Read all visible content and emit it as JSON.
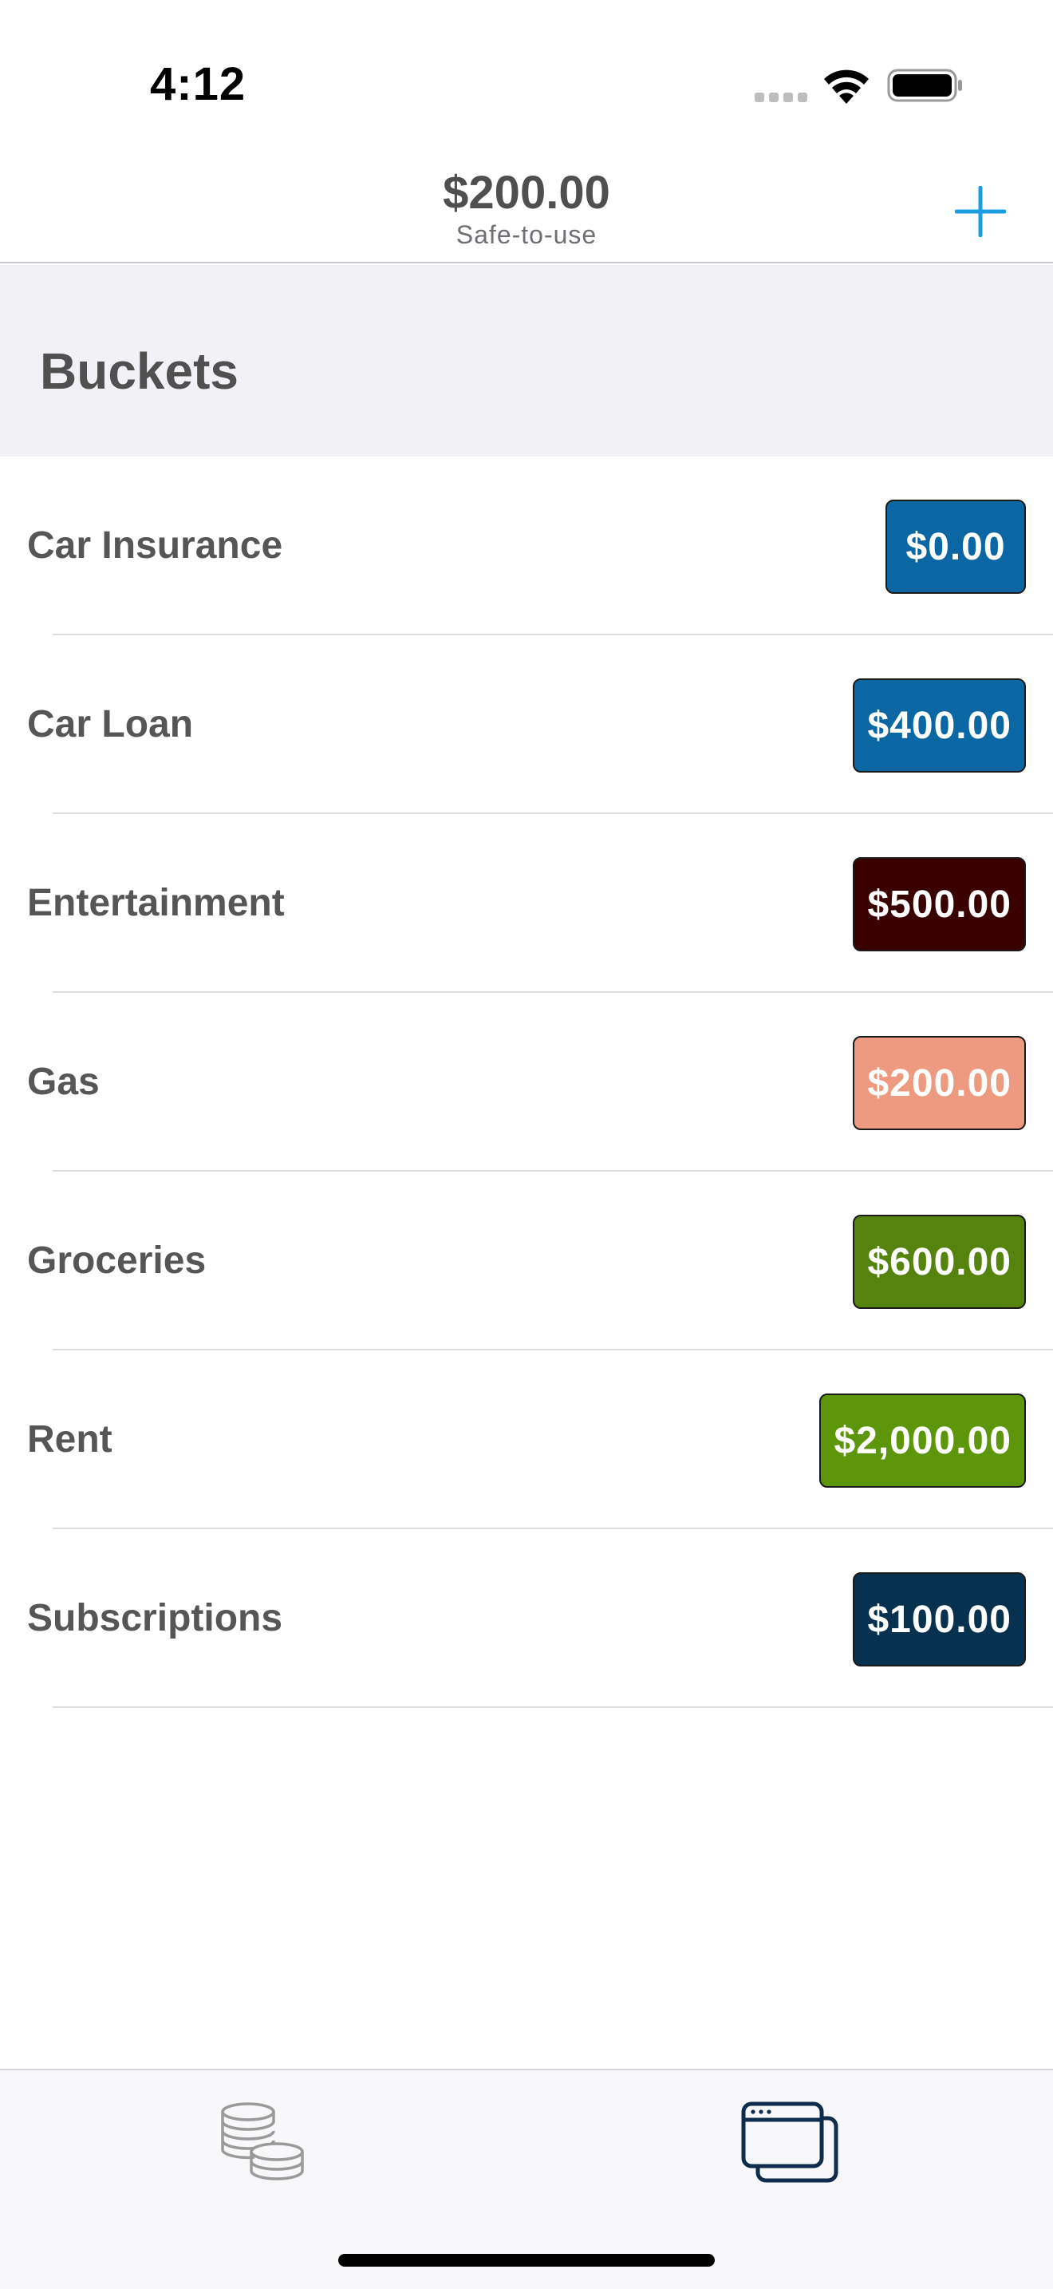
{
  "status_bar": {
    "time": "4:12"
  },
  "header": {
    "amount": "$200.00",
    "subtitle": "Safe-to-use",
    "add_icon": "plus-icon"
  },
  "section": {
    "title": "Buckets"
  },
  "buckets": [
    {
      "name": "Car Insurance",
      "amount": "$0.00",
      "color": "#0b67a3"
    },
    {
      "name": "Car Loan",
      "amount": "$400.00",
      "color": "#0b67a3"
    },
    {
      "name": "Entertainment",
      "amount": "$500.00",
      "color": "#3a0000"
    },
    {
      "name": "Gas",
      "amount": "$200.00",
      "color": "#ee9a80"
    },
    {
      "name": "Groceries",
      "amount": "$600.00",
      "color": "#56830e"
    },
    {
      "name": "Rent",
      "amount": "$2,000.00",
      "color": "#5d960a"
    },
    {
      "name": "Subscriptions",
      "amount": "$100.00",
      "color": "#06314f"
    }
  ],
  "tab_bar": {
    "tabs": [
      {
        "icon": "coins-icon",
        "selected": false
      },
      {
        "icon": "windows-icon",
        "selected": true
      }
    ]
  },
  "colors": {
    "accent": "#1a9ee0",
    "text": "#565656",
    "selected_tab": "#0f2d4a",
    "unselected_tab": "#9a9a9a"
  }
}
